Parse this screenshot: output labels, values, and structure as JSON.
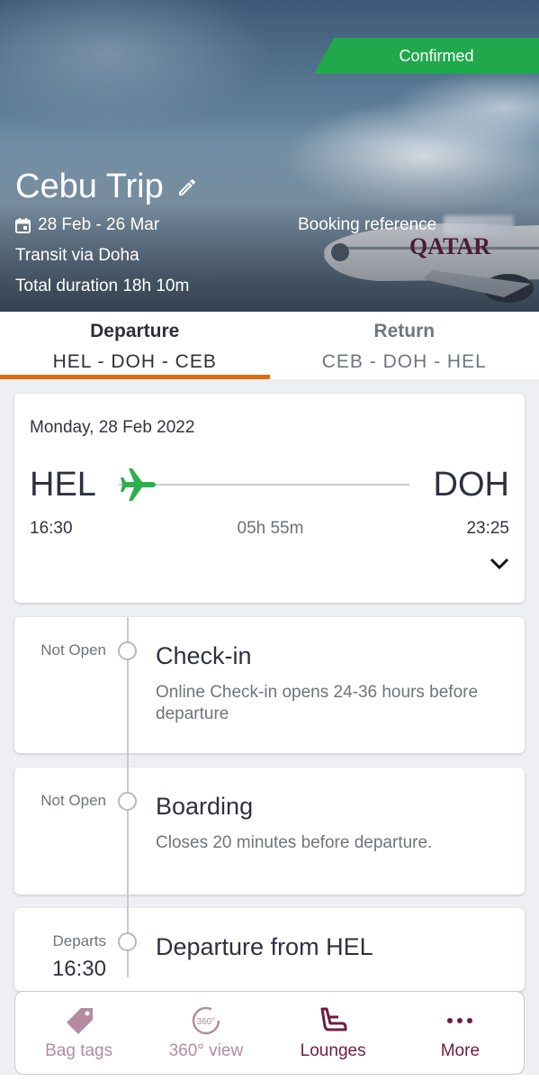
{
  "header": {
    "status_badge": "Confirmed",
    "trip_title": "Cebu Trip",
    "dates": "28 Feb - 26 Mar",
    "transit": "Transit via Doha",
    "total_duration": "Total duration 18h 10m",
    "booking_reference_label": "Booking reference"
  },
  "tabs": [
    {
      "label": "Departure",
      "route": "HEL - DOH - CEB"
    },
    {
      "label": "Return",
      "route": "CEB - DOH - HEL"
    }
  ],
  "flight": {
    "date": "Monday, 28 Feb 2022",
    "from": "HEL",
    "to": "DOH",
    "departure_time": "16:30",
    "duration": "05h 55m",
    "arrival_time": "23:25"
  },
  "timeline": [
    {
      "status": "Not Open",
      "title": "Check-in",
      "description": "Online Check-in opens 24-36 hours before departure"
    },
    {
      "status": "Not Open",
      "title": "Boarding",
      "description": "Closes 20 minutes before departure."
    },
    {
      "status": "Departs",
      "time": "16:30",
      "title": "Departure from HEL"
    }
  ],
  "bottom_nav": [
    {
      "label": "Bag tags",
      "icon": "tag-icon"
    },
    {
      "label": "360° view",
      "icon": "360-icon"
    },
    {
      "label": "Lounges",
      "icon": "seat-icon"
    },
    {
      "label": "More",
      "icon": "more-dots-icon"
    }
  ],
  "colors": {
    "accent_orange": "#e06b14",
    "confirmed_green": "#20a84c",
    "plane_green": "#2fae4f",
    "brand_burgundy": "#6f1d45"
  }
}
